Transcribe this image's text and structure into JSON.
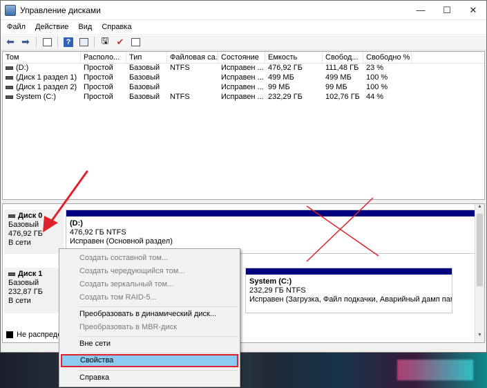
{
  "window": {
    "title": "Управление дисками",
    "controls": {
      "minimize": "—",
      "maximize": "☐",
      "close": "✕"
    }
  },
  "menu": [
    "Файл",
    "Действие",
    "Вид",
    "Справка"
  ],
  "toolbar": {
    "icons": [
      "back-arrow-icon",
      "forward-arrow-icon",
      "console-tree-icon",
      "help-icon",
      "properties-icon",
      "connect-disk-icon",
      "checklist-icon"
    ]
  },
  "volume_table": {
    "headers": [
      "Том",
      "Располо...",
      "Тип",
      "Файловая са...",
      "Состояние",
      "Емкость",
      "Свобод...",
      "Свободно %"
    ],
    "rows": [
      [
        "(D:)",
        "Простой",
        "Базовый",
        "NTFS",
        "Исправен ...",
        "476,92 ГБ",
        "111,48 ГБ",
        "23 %"
      ],
      [
        "(Диск 1 раздел 1)",
        "Простой",
        "Базовый",
        "",
        "Исправен ...",
        "499 МБ",
        "499 МБ",
        "100 %"
      ],
      [
        "(Диск 1 раздел 2)",
        "Простой",
        "Базовый",
        "",
        "Исправен ...",
        "99 МБ",
        "99 МБ",
        "100 %"
      ],
      [
        "System (C:)",
        "Простой",
        "Базовый",
        "NTFS",
        "Исправен ...",
        "232,29 ГБ",
        "102,76 ГБ",
        "44 %"
      ]
    ]
  },
  "disks": [
    {
      "name": "Диск 0",
      "type": "Базовый",
      "size": "476,92 ГБ",
      "status": "В сети",
      "partition": {
        "name": "(D:)",
        "fs": "476,92 ГБ NTFS",
        "state": "Исправен (Основной раздел)"
      }
    },
    {
      "name": "Диск 1",
      "type": "Базовый",
      "size": "232,87 ГБ",
      "status": "В сети",
      "partition": {
        "name": "System  (C:)",
        "fs": "232,29 ГБ NTFS",
        "state": "Исправен (Загрузка, Файл подкачки, Аварийный дамп памя"
      }
    }
  ],
  "legend": {
    "unallocated": "Не распредел"
  },
  "context_menu": {
    "items": [
      {
        "label": "Создать составной том...",
        "disabled": true
      },
      {
        "label": "Создать чередующийся том...",
        "disabled": true
      },
      {
        "label": "Создать зеркальный том...",
        "disabled": true
      },
      {
        "label": "Создать том RAID-5...",
        "disabled": true
      },
      {
        "label": "Преобразовать в динамический диск...",
        "disabled": false
      },
      {
        "label": "Преобразовать в MBR-диск",
        "disabled": true
      },
      {
        "label": "Вне сети",
        "disabled": false
      },
      {
        "label": "Свойства",
        "disabled": false,
        "highlighted": true
      },
      {
        "label": "Справка",
        "disabled": false
      }
    ]
  },
  "colors": {
    "partition_bar": "#000080",
    "highlight": "#8ccbf2",
    "annotation": "#e0202a"
  }
}
